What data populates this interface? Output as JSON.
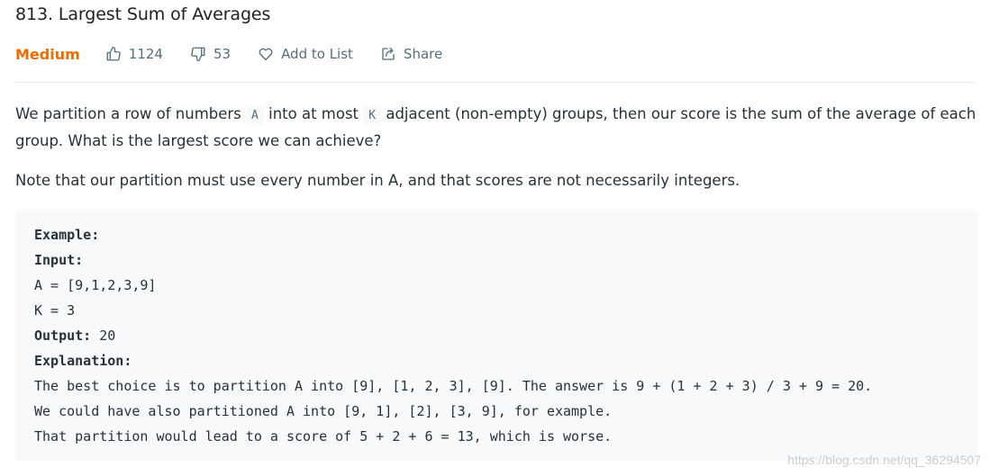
{
  "problem": {
    "title": "813. Largest Sum of Averages",
    "difficulty": "Medium",
    "likes": "1124",
    "dislikes": "53",
    "add_to_list": "Add to List",
    "share": "Share"
  },
  "description": {
    "p1_a": "We partition a row of numbers ",
    "p1_code_a": "A",
    "p1_b": " into at most ",
    "p1_code_k": "K",
    "p1_c": " adjacent (non-empty) groups, then our score is the sum of the average of each group. What is the largest score we can achieve?",
    "p2": "Note that our partition must use every number in A, and that scores are not necessarily integers."
  },
  "example": {
    "label_example": "Example:",
    "label_input": "Input:",
    "input_a": "A = [9,1,2,3,9]",
    "input_k": "K = 3",
    "label_output": "Output:",
    "output_value": " 20",
    "label_explanation": "Explanation:",
    "expl_1": "The best choice is to partition A into [9], [1, 2, 3], [9]. The answer is 9 + (1 + 2 + 3) / 3 + 9 = 20.",
    "expl_2": "We could have also partitioned A into [9, 1], [2], [3, 9], for example.",
    "expl_3": "That partition would lead to a score of 5 + 2 + 6 = 13, which is worse."
  },
  "watermark": "https://blog.csdn.net/qq_36294507",
  "colors": {
    "difficulty_medium": "#ef6c00",
    "meta_text": "#546e7a",
    "code_bg": "#f7f9fa"
  },
  "icons": {
    "like": "thumbs-up-icon",
    "dislike": "thumbs-down-icon",
    "favorite": "heart-icon",
    "share": "share-icon"
  }
}
